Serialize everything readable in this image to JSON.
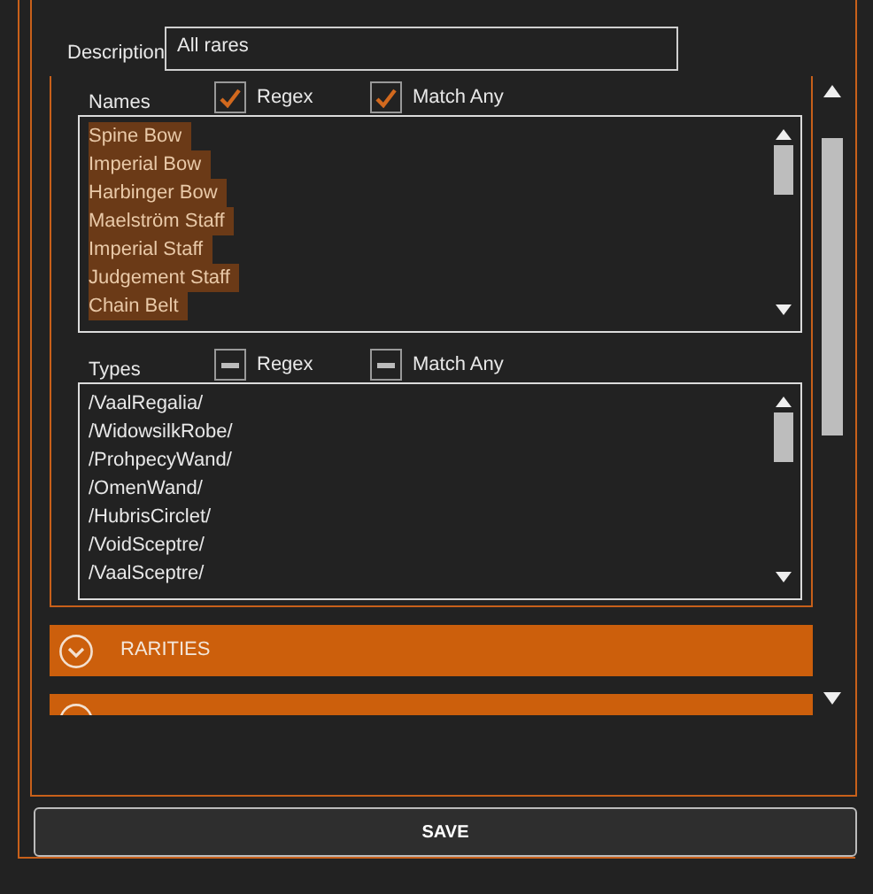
{
  "description": {
    "label": "Description",
    "value": "All rares"
  },
  "names": {
    "label": "Names",
    "regex": {
      "checked": true
    },
    "match_any": {
      "checked": true
    },
    "regex_label": "Regex",
    "match_any_label": "Match Any",
    "items": [
      {
        "text": "Spine Bow",
        "selected": true
      },
      {
        "text": "Imperial Bow",
        "selected": true
      },
      {
        "text": "Harbinger Bow",
        "selected": true
      },
      {
        "text": "Maelström Staff",
        "selected": true
      },
      {
        "text": "Imperial Staff",
        "selected": true
      },
      {
        "text": "Judgement Staff",
        "selected": true
      },
      {
        "text": "Chain Belt",
        "selected": true
      }
    ]
  },
  "types": {
    "label": "Types",
    "regex": {
      "indeterminate": true
    },
    "match_any": {
      "indeterminate": true
    },
    "regex_label": "Regex",
    "match_any_label": "Match Any",
    "items": [
      {
        "text": "/VaalRegalia/",
        "selected": false
      },
      {
        "text": "/WidowsilkRobe/",
        "selected": false
      },
      {
        "text": "/ProhpecyWand/",
        "selected": false
      },
      {
        "text": "/OmenWand/",
        "selected": false
      },
      {
        "text": "/HubrisCirclet/",
        "selected": false
      },
      {
        "text": "/VoidSceptre/",
        "selected": false
      },
      {
        "text": "/VaalSceptre/",
        "selected": false
      }
    ]
  },
  "sections": [
    {
      "title": "RARITIES",
      "expanded": false
    },
    {
      "expanded": false
    }
  ],
  "save_button": "SAVE"
}
